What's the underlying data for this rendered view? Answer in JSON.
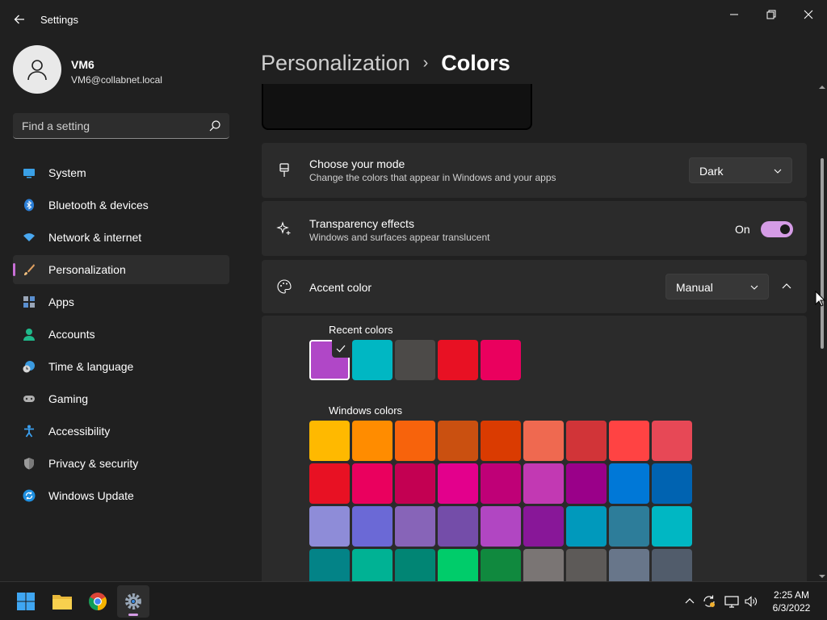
{
  "window": {
    "app_title": "Settings",
    "back_icon": "back-arrow-icon",
    "controls": [
      "minimize-icon",
      "restore-icon",
      "close-icon"
    ]
  },
  "profile": {
    "name": "VM6",
    "email": "VM6@collabnet.local",
    "avatar_icon": "user-avatar-icon"
  },
  "search": {
    "placeholder": "Find a setting",
    "icon": "search-icon"
  },
  "nav": {
    "items": [
      {
        "label": "System",
        "icon": "system-icon",
        "active": false
      },
      {
        "label": "Bluetooth & devices",
        "icon": "bluetooth-icon",
        "active": false
      },
      {
        "label": "Network & internet",
        "icon": "wifi-icon",
        "active": false
      },
      {
        "label": "Personalization",
        "icon": "brush-icon",
        "active": true
      },
      {
        "label": "Apps",
        "icon": "apps-icon",
        "active": false
      },
      {
        "label": "Accounts",
        "icon": "accounts-icon",
        "active": false
      },
      {
        "label": "Time & language",
        "icon": "clock-globe-icon",
        "active": false
      },
      {
        "label": "Gaming",
        "icon": "gamepad-icon",
        "active": false
      },
      {
        "label": "Accessibility",
        "icon": "accessibility-icon",
        "active": false
      },
      {
        "label": "Privacy & security",
        "icon": "shield-icon",
        "active": false
      },
      {
        "label": "Windows Update",
        "icon": "update-icon",
        "active": false
      }
    ]
  },
  "breadcrumb": {
    "parent": "Personalization",
    "separator": "›",
    "current": "Colors"
  },
  "mode": {
    "title": "Choose your mode",
    "description": "Change the colors that appear in Windows and your apps",
    "value": "Dark",
    "icon": "paintbrush-icon"
  },
  "transparency": {
    "title": "Transparency effects",
    "description": "Windows and surfaces appear translucent",
    "state_label": "On",
    "enabled": true,
    "icon": "sparkle-icon"
  },
  "accent": {
    "title": "Accent color",
    "value": "Manual",
    "icon": "palette-icon",
    "expanded": true
  },
  "recent_colors": {
    "label": "Recent colors",
    "colors": [
      "#b047c7",
      "#00b7c3",
      "#4c4a48",
      "#e81123",
      "#ea005e"
    ],
    "selected_index": 0
  },
  "windows_colors": {
    "label": "Windows colors",
    "rows": [
      [
        "#ffb900",
        "#ff8c00",
        "#f7630c",
        "#ca5010",
        "#da3b01",
        "#ef6950",
        "#d13438",
        "#ff4343",
        "#e74856"
      ],
      [
        "#e81123",
        "#ea005e",
        "#c30052",
        "#e3008c",
        "#bf0077",
        "#c239b3",
        "#9a0089",
        "#0078d7",
        "#0063b1"
      ],
      [
        "#8e8cd8",
        "#6b69d6",
        "#8764b8",
        "#744da9",
        "#b146c2",
        "#881798",
        "#0099bc",
        "#2d7d9a",
        "#00b7c3"
      ],
      [
        "#038387",
        "#00b294",
        "#018574",
        "#00cc6a",
        "#10893e",
        "#7a7574",
        "#5d5a58",
        "#68768a",
        "#515c6b"
      ]
    ]
  },
  "accent_colors": {
    "toggle": "#d59ce6",
    "nav_indicator": "#c86fd6"
  },
  "taskbar": {
    "apps": [
      "windows-start-icon",
      "file-explorer-icon",
      "chrome-icon",
      "settings-gear-icon"
    ],
    "tray": [
      "chevron-up-icon",
      "sync-icon",
      "display-icon",
      "volume-icon"
    ],
    "time": "2:25 AM",
    "date": "6/3/2022"
  }
}
